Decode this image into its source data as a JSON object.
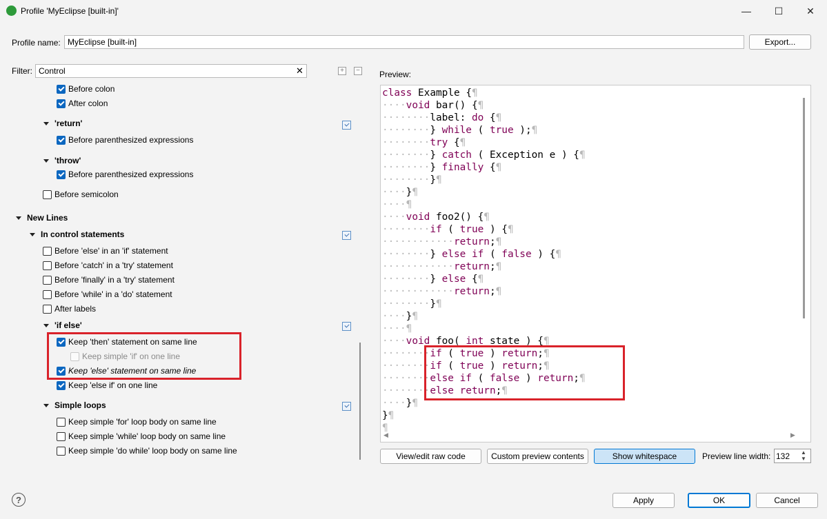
{
  "window": {
    "title": "Profile 'MyEclipse [built-in]'",
    "minimize": "—",
    "maximize": "☐",
    "close": "✕"
  },
  "profile": {
    "label": "Profile name:",
    "value": "MyEclipse [built-in]",
    "export_label": "Export..."
  },
  "filter": {
    "label": "Filter:",
    "value": "Control",
    "clear": "✕",
    "expand_all": "+",
    "collapse_all": "−"
  },
  "tree": {
    "before_colon": "Before colon",
    "after_colon": "After colon",
    "return_group": "'return'",
    "return_before_paren": "Before parenthesized expressions",
    "throw_group": "'throw'",
    "throw_before_paren": "Before parenthesized expressions",
    "before_semicolon": "Before semicolon",
    "new_lines": "New Lines",
    "in_control": "In control statements",
    "before_else": "Before 'else' in an 'if' statement",
    "before_catch": "Before 'catch' in a 'try' statement",
    "before_finally": "Before 'finally' in a 'try' statement",
    "before_while": "Before 'while' in a 'do' statement",
    "after_labels": "After labels",
    "if_else": "'if else'",
    "keep_then": "Keep 'then' statement on same line",
    "keep_simple_if": "Keep simple 'if' on one line",
    "keep_else": "Keep 'else' statement on same line",
    "keep_else_if": "Keep 'else if' on one line",
    "simple_loops": "Simple loops",
    "keep_for": "Keep simple 'for' loop body on same line",
    "keep_while": "Keep simple 'while' loop body on same line",
    "keep_do_while": "Keep simple 'do while' loop body on same line"
  },
  "preview": {
    "label": "Preview:",
    "code_lines": [
      "class Example {¶",
      "····void bar() {¶",
      "········label: do {¶",
      "········} while ( true );¶",
      "········try {¶",
      "········} catch ( Exception e ) {¶",
      "········} finally {¶",
      "········}¶",
      "····}¶",
      "····¶",
      "····void foo2() {¶",
      "········if ( true ) {¶",
      "············return;¶",
      "········} else if ( false ) {¶",
      "············return;¶",
      "········} else {¶",
      "············return;¶",
      "········}¶",
      "····}¶",
      "····¶",
      "····void foo( int state ) {¶",
      "········if ( true ) return;¶",
      "········if ( true ) return;¶",
      "········else if ( false ) return;¶",
      "········else return;¶",
      "····}¶",
      "}¶",
      "¶"
    ],
    "keywords": [
      "class",
      "void",
      "do",
      "while",
      "true",
      "try",
      "catch",
      "finally",
      "if",
      "else",
      "false",
      "return",
      "int"
    ],
    "view_raw": "View/edit raw code",
    "custom_preview": "Custom preview contents",
    "show_whitespace": "Show whitespace",
    "line_width_label": "Preview line width:",
    "line_width_value": "132"
  },
  "footer": {
    "help": "?",
    "apply": "Apply",
    "ok": "OK",
    "cancel": "Cancel"
  },
  "colors": {
    "keyword": "#7f0055",
    "whitespace": "#b8b8b8",
    "highlight": "#d9222a",
    "checkbox": "#0c67c0"
  }
}
